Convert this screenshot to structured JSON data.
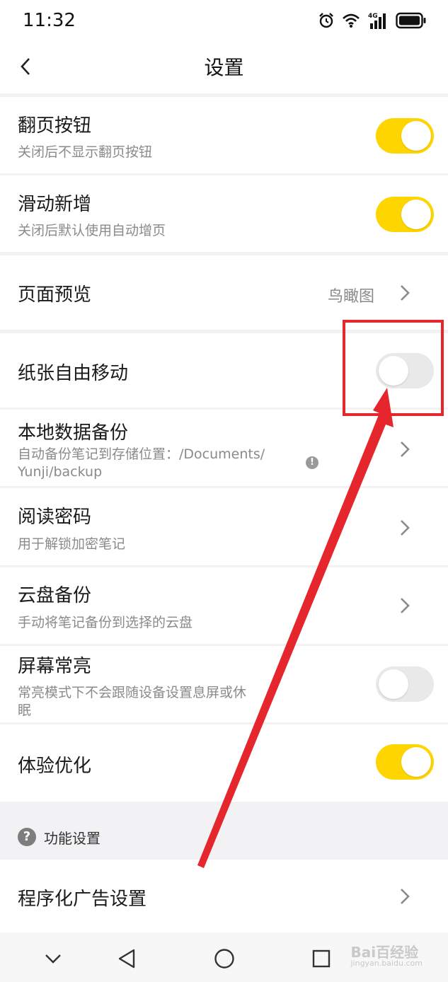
{
  "status_bar": {
    "time": "11:32",
    "network_label": "4G"
  },
  "header": {
    "title": "设置"
  },
  "settings": {
    "page_turn": {
      "title": "翻页按钮",
      "subtitle": "关闭后不显示翻页按钮",
      "enabled": true
    },
    "swipe_add": {
      "title": "滑动新增",
      "subtitle": "关闭后默认使用自动增页",
      "enabled": true
    },
    "page_preview": {
      "title": "页面预览",
      "value": "鸟瞰图"
    },
    "free_paper": {
      "title": "纸张自由移动",
      "enabled": false
    },
    "local_backup": {
      "title": "本地数据备份",
      "subtitle_line1": "自动备份笔记到存储位置：/Documents/",
      "subtitle_line2": "Yunji/backup"
    },
    "read_password": {
      "title": "阅读密码",
      "subtitle": "用于解锁加密笔记"
    },
    "cloud_backup": {
      "title": "云盘备份",
      "subtitle": "手动将笔记备份到选择的云盘"
    },
    "screen_on": {
      "title": "屏幕常亮",
      "subtitle_line1": "常亮模式下不会跟随设备设置息屏或休",
      "subtitle_line2": "眠",
      "enabled": false
    },
    "experience": {
      "title": "体验优化",
      "enabled": true
    }
  },
  "section": {
    "label": "功能设置",
    "help_glyph": "?"
  },
  "ad_settings": {
    "title": "程序化广告设置"
  },
  "info_glyph": "!",
  "watermark": {
    "brand": "Bai百经验",
    "url": "jingyan.baidu.com"
  },
  "colors": {
    "accent_yellow": "#ffd500",
    "toggle_off": "#e9e9e9",
    "annotation_red": "#e5262c"
  },
  "icons": [
    "back-icon",
    "chevron-right-icon",
    "info-icon",
    "help-icon",
    "alarm-icon",
    "wifi-icon",
    "signal-icon",
    "battery-icon"
  ]
}
